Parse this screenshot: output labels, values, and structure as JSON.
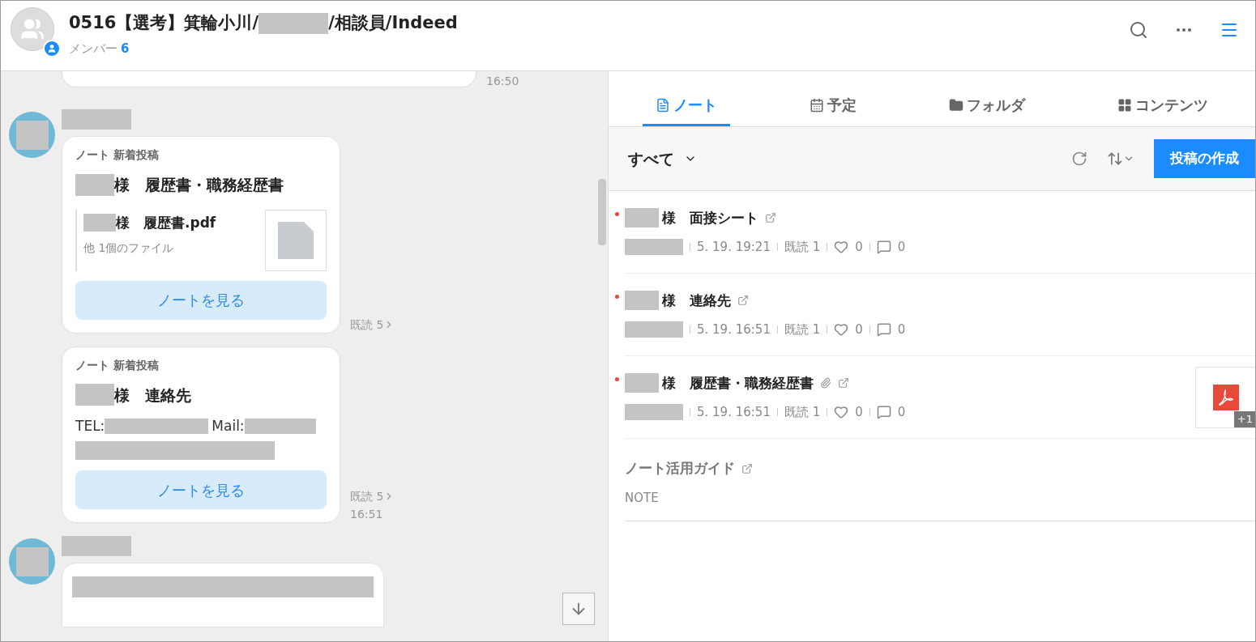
{
  "header": {
    "title_before": "0516【選考】箕輪小川/",
    "title_after": "/相談員/Indeed",
    "members_label": "メンバー",
    "members_count": "6"
  },
  "chat": {
    "top_time": "16:50",
    "messages": [
      {
        "kind": "note",
        "show_avatar": true,
        "label": "ノート 新着投稿",
        "title": "様　履歴書・職務経歴書",
        "file_name": "様　履歴書.pdf",
        "file_more": "他 1個のファイル",
        "button": "ノートを見る",
        "read": "既読 5"
      },
      {
        "kind": "contact",
        "show_avatar": false,
        "label": "ノート 新着投稿",
        "title": "様　連絡先",
        "tel_label": "TEL:",
        "mail_label": "Mail:",
        "button": "ノートを見る",
        "read": "既読 5",
        "time": "16:51"
      },
      {
        "kind": "text",
        "show_avatar": true
      }
    ]
  },
  "tabs": [
    {
      "label": "ノート",
      "selected": true
    },
    {
      "label": "予定",
      "selected": false
    },
    {
      "label": "フォルダ",
      "selected": false
    },
    {
      "label": "コンテンツ",
      "selected": false
    }
  ],
  "toolbar": {
    "filter": "すべて",
    "create_button": "投稿の作成"
  },
  "notes": [
    {
      "kind": "post",
      "unread": true,
      "title": "様　面接シート",
      "attachment": false,
      "date": "5. 19. 19:21",
      "read": "既読 1",
      "likes": "0",
      "comments": "0"
    },
    {
      "kind": "post",
      "unread": true,
      "title": "様　連絡先",
      "attachment": false,
      "date": "5. 19. 16:51",
      "read": "既読 1",
      "likes": "0",
      "comments": "0"
    },
    {
      "kind": "post",
      "unread": true,
      "title": "様　履歴書・職務経歴書",
      "attachment": true,
      "thumb_count": "+1",
      "date": "5. 19. 16:51",
      "read": "既読 1",
      "likes": "0",
      "comments": "0"
    },
    {
      "kind": "guide",
      "title": "ノート活用ガイド",
      "subtitle": "NOTE"
    }
  ]
}
